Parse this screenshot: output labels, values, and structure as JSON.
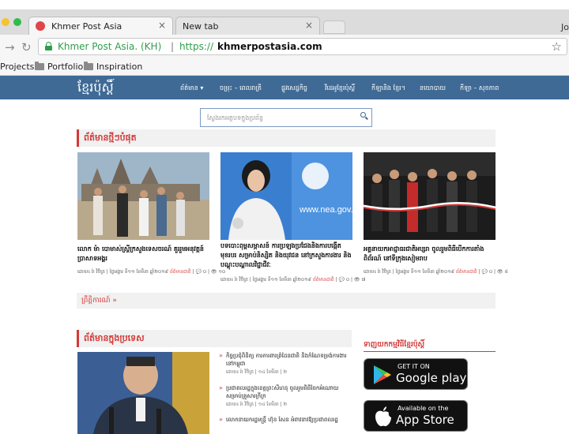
{
  "browser": {
    "tabs": [
      {
        "title": "Khmer Post Asia",
        "close": "×"
      },
      {
        "title": "New tab",
        "close": "×"
      }
    ],
    "profile": "Jo",
    "address": {
      "site_label": "Khmer Post Asia. (KH)",
      "separator": "|",
      "protocol": "https://",
      "host": "khmerpostasia.com"
    },
    "bookmarks": [
      "Projects",
      "Portfolio",
      "Inspiration"
    ],
    "icons": [
      "back-arrow-icon",
      "reload-icon",
      "lock-icon",
      "star-icon",
      "folder-icon"
    ]
  },
  "site": {
    "logo": "ខ្មែរប៉ុស្ដិ៍",
    "nav": [
      "ព័ត៌មាន ▾",
      "ចម្រុះ – ពេលរាត្រី",
      "ផ្លូវសេដ្ឋកិច្ច",
      "វីដេអូខ្មែរប៉ុស្ដិ៍",
      "កីឡានិង ខ្មែរ។",
      "នយោបាយ",
      "កីឡា – សុខភាព"
    ],
    "search_placeholder": "ស្វែងរកអត្ថបទក្នុងប្រព័ន្ធ",
    "accent": "#3e6a95",
    "red": "#d23a3a"
  },
  "latest": {
    "heading": "ព័ត៌មានថ្មីៗបំផុត",
    "cards": [
      {
        "title": "លោក ម៉ា បោមាស់ស្ដ្រីក្រសួងទេសចរណ៍ គួររួមអនុវត្តន៍ប្រាសាទអង្គរ",
        "meta": "ដោយ៖ រ៉ា វិចិត្រ | ថ្ងៃអង្គារ ទី១១ ខែមីនា ឆ្នាំ២០១៩",
        "cat": "ព័ត៌មានជាតិ",
        "counts": "| 💬 ០ | 👁 ១០"
      },
      {
        "title": "បទបោះពុម្ពសម្ភាសន៍ ការប្រឡងប្រជែងនិងការបង្កើតមុខរបរ សម្រាប់និស្សិត និងយុវជន នៅក្រសួងការងារ និងបណ្ដុះបណ្ដាលវិជ្ជាជីវៈ",
        "meta": "ដោយ៖ រ៉ា វិចិត្រ | ថ្ងៃអង្គារ ទី១១ ខែមីនា ឆ្នាំ២០១៩",
        "cat": "ព័ត៌មានជាតិ",
        "counts": "| 💬 ០ | 👁 ៧"
      },
      {
        "title": "អគ្គនាយកអាជ្ញាធរជាតិអប្សរា ចូលរួមពិធីបើកការតាំងពិព័រណ៍ នៅទីក្រុងសៀមរាប",
        "meta": "ដោយ៖ រ៉ា វិចិត្រ | ថ្ងៃអង្គារ ទី១១ ខែមីនា ឆ្នាំ២០១៩",
        "cat": "ព័ត៌មានជាតិ",
        "counts": "| 💬 ០ | 👁 ៥"
      }
    ],
    "more": "ព្រឹត្តិការណ៍ »"
  },
  "local": {
    "heading": "ព័ត៌មានក្នុងប្រទេស",
    "items": [
      {
        "title": "កិច្ចប្រជុំពិនិត្យ ការការពារព្រំដែនជាតិ និងកំណែទម្រង់ការងារ នៅកម្ពុជា",
        "meta": "ដោយ៖ រ៉ា វិចិត្រ | ១៤ ខែមីនា | ២"
      },
      {
        "title": "ប្រជាពលរដ្ឋក្នុងខេត្តព្រះសីហនុ ចូលរួមពិធីចែកអំណោយ សម្រាប់គ្រួសារក្រីក្រ",
        "meta": "ដោយ៖ រ៉ា វិចិត្រ | ១៤ ខែមីនា | ២"
      },
      {
        "title": "លោកនាយករដ្ឋមន្ត្រី ហ៊ុន សែន អំពាវនាវឱ្យប្រជាពលរដ្ឋ",
        "meta": ""
      }
    ]
  },
  "app": {
    "heading": "ទាញយកកម្មវិធីខ្មែរប៉ុស្ដិ៍",
    "google": {
      "small": "GET IT ON",
      "big": "Google play"
    },
    "apple": {
      "small": "Available on the",
      "big": "App Store"
    }
  }
}
